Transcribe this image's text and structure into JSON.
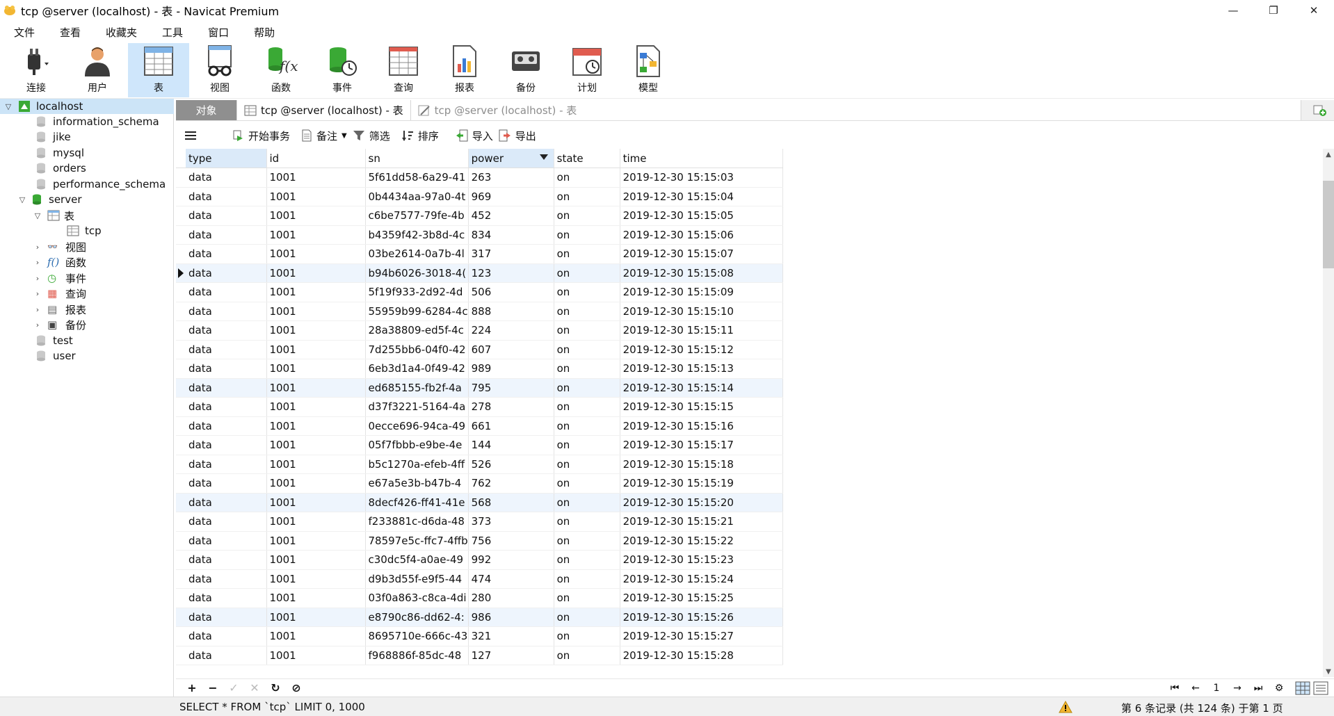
{
  "window": {
    "title": "tcp @server (localhost) - 表 - Navicat Premium",
    "minimize": "—",
    "restore": "❐",
    "close": "✕"
  },
  "menu": [
    "文件",
    "查看",
    "收藏夹",
    "工具",
    "窗口",
    "帮助"
  ],
  "toolbar": [
    {
      "label": "连接",
      "icon": "plug-icon"
    },
    {
      "label": "用户",
      "icon": "user-icon"
    },
    {
      "label": "表",
      "icon": "table-icon",
      "active": true
    },
    {
      "label": "视图",
      "icon": "view-icon"
    },
    {
      "label": "函数",
      "icon": "function-icon"
    },
    {
      "label": "事件",
      "icon": "event-icon"
    },
    {
      "label": "查询",
      "icon": "query-icon"
    },
    {
      "label": "报表",
      "icon": "report-icon"
    },
    {
      "label": "备份",
      "icon": "backup-icon"
    },
    {
      "label": "计划",
      "icon": "schedule-icon"
    },
    {
      "label": "模型",
      "icon": "model-icon"
    }
  ],
  "tree": {
    "connection": "localhost",
    "databases_top": [
      "information_schema",
      "jike",
      "mysql",
      "orders",
      "performance_schema"
    ],
    "server": "server",
    "tables_group": "表",
    "table": "tcp",
    "groups": [
      "视图",
      "函数",
      "事件",
      "查询",
      "报表",
      "备份"
    ],
    "databases_bottom": [
      "test",
      "user"
    ]
  },
  "tabs": {
    "objects": "对象",
    "active": "tcp @server (localhost) - 表",
    "inactive": "tcp @server (localhost) - 表"
  },
  "objbar": {
    "begin_tx": "开始事务",
    "note": "备注",
    "filter": "筛选",
    "sort": "排序",
    "import": "导入",
    "export": "导出"
  },
  "grid": {
    "columns": [
      "type",
      "id",
      "sn",
      "power",
      "state",
      "time"
    ],
    "selected_row": 5,
    "rows": [
      [
        "data",
        "1001",
        "5f61dd58-6a29-41",
        "263",
        "on",
        "2019-12-30 15:15:03"
      ],
      [
        "data",
        "1001",
        "0b4434aa-97a0-4t",
        "969",
        "on",
        "2019-12-30 15:15:04"
      ],
      [
        "data",
        "1001",
        "c6be7577-79fe-4b",
        "452",
        "on",
        "2019-12-30 15:15:05"
      ],
      [
        "data",
        "1001",
        "b4359f42-3b8d-4c",
        "834",
        "on",
        "2019-12-30 15:15:06"
      ],
      [
        "data",
        "1001",
        "03be2614-0a7b-4l",
        "317",
        "on",
        "2019-12-30 15:15:07"
      ],
      [
        "data",
        "1001",
        "b94b6026-3018-4(",
        "123",
        "on",
        "2019-12-30 15:15:08"
      ],
      [
        "data",
        "1001",
        "5f19f933-2d92-4d",
        "506",
        "on",
        "2019-12-30 15:15:09"
      ],
      [
        "data",
        "1001",
        "55959b99-6284-4c",
        "888",
        "on",
        "2019-12-30 15:15:10"
      ],
      [
        "data",
        "1001",
        "28a38809-ed5f-4c",
        "224",
        "on",
        "2019-12-30 15:15:11"
      ],
      [
        "data",
        "1001",
        "7d255bb6-04f0-42",
        "607",
        "on",
        "2019-12-30 15:15:12"
      ],
      [
        "data",
        "1001",
        "6eb3d1a4-0f49-42",
        "989",
        "on",
        "2019-12-30 15:15:13"
      ],
      [
        "data",
        "1001",
        "ed685155-fb2f-4a",
        "795",
        "on",
        "2019-12-30 15:15:14"
      ],
      [
        "data",
        "1001",
        "d37f3221-5164-4a",
        "278",
        "on",
        "2019-12-30 15:15:15"
      ],
      [
        "data",
        "1001",
        "0ecce696-94ca-49",
        "661",
        "on",
        "2019-12-30 15:15:16"
      ],
      [
        "data",
        "1001",
        "05f7fbbb-e9be-4e",
        "144",
        "on",
        "2019-12-30 15:15:17"
      ],
      [
        "data",
        "1001",
        "b5c1270a-efeb-4ff",
        "526",
        "on",
        "2019-12-30 15:15:18"
      ],
      [
        "data",
        "1001",
        "e67a5e3b-b47b-4",
        "762",
        "on",
        "2019-12-30 15:15:19"
      ],
      [
        "data",
        "1001",
        "8decf426-ff41-41e",
        "568",
        "on",
        "2019-12-30 15:15:20"
      ],
      [
        "data",
        "1001",
        "f233881c-d6da-48",
        "373",
        "on",
        "2019-12-30 15:15:21"
      ],
      [
        "data",
        "1001",
        "78597e5c-ffc7-4ffb",
        "756",
        "on",
        "2019-12-30 15:15:22"
      ],
      [
        "data",
        "1001",
        "c30dc5f4-a0ae-49",
        "992",
        "on",
        "2019-12-30 15:15:23"
      ],
      [
        "data",
        "1001",
        "d9b3d55f-e9f5-44",
        "474",
        "on",
        "2019-12-30 15:15:24"
      ],
      [
        "data",
        "1001",
        "03f0a863-c8ca-4di",
        "280",
        "on",
        "2019-12-30 15:15:25"
      ],
      [
        "data",
        "1001",
        "e8790c86-dd62-4:",
        "986",
        "on",
        "2019-12-30 15:15:26"
      ],
      [
        "data",
        "1001",
        "8695710e-666c-43",
        "321",
        "on",
        "2019-12-30 15:15:27"
      ],
      [
        "data",
        "1001",
        "f968886f-85dc-48",
        "127",
        "on",
        "2019-12-30 15:15:28"
      ]
    ]
  },
  "gridbar": {
    "add": "+",
    "remove": "−",
    "apply": "✓",
    "cancel": "✕",
    "refresh": "↻",
    "stop": "⊘",
    "first": "⏮",
    "prev": "←",
    "page": "1",
    "next": "→",
    "last": "⏭",
    "settings": "⚙"
  },
  "status": {
    "sql": "SELECT * FROM `tcp` LIMIT 0, 1000",
    "records": "第 6 条记录 (共 124 条) 于第 1 页"
  },
  "colors": {
    "accent": "#cfe6fb",
    "green": "#3aa935",
    "alt_row": "#eef5fd"
  }
}
